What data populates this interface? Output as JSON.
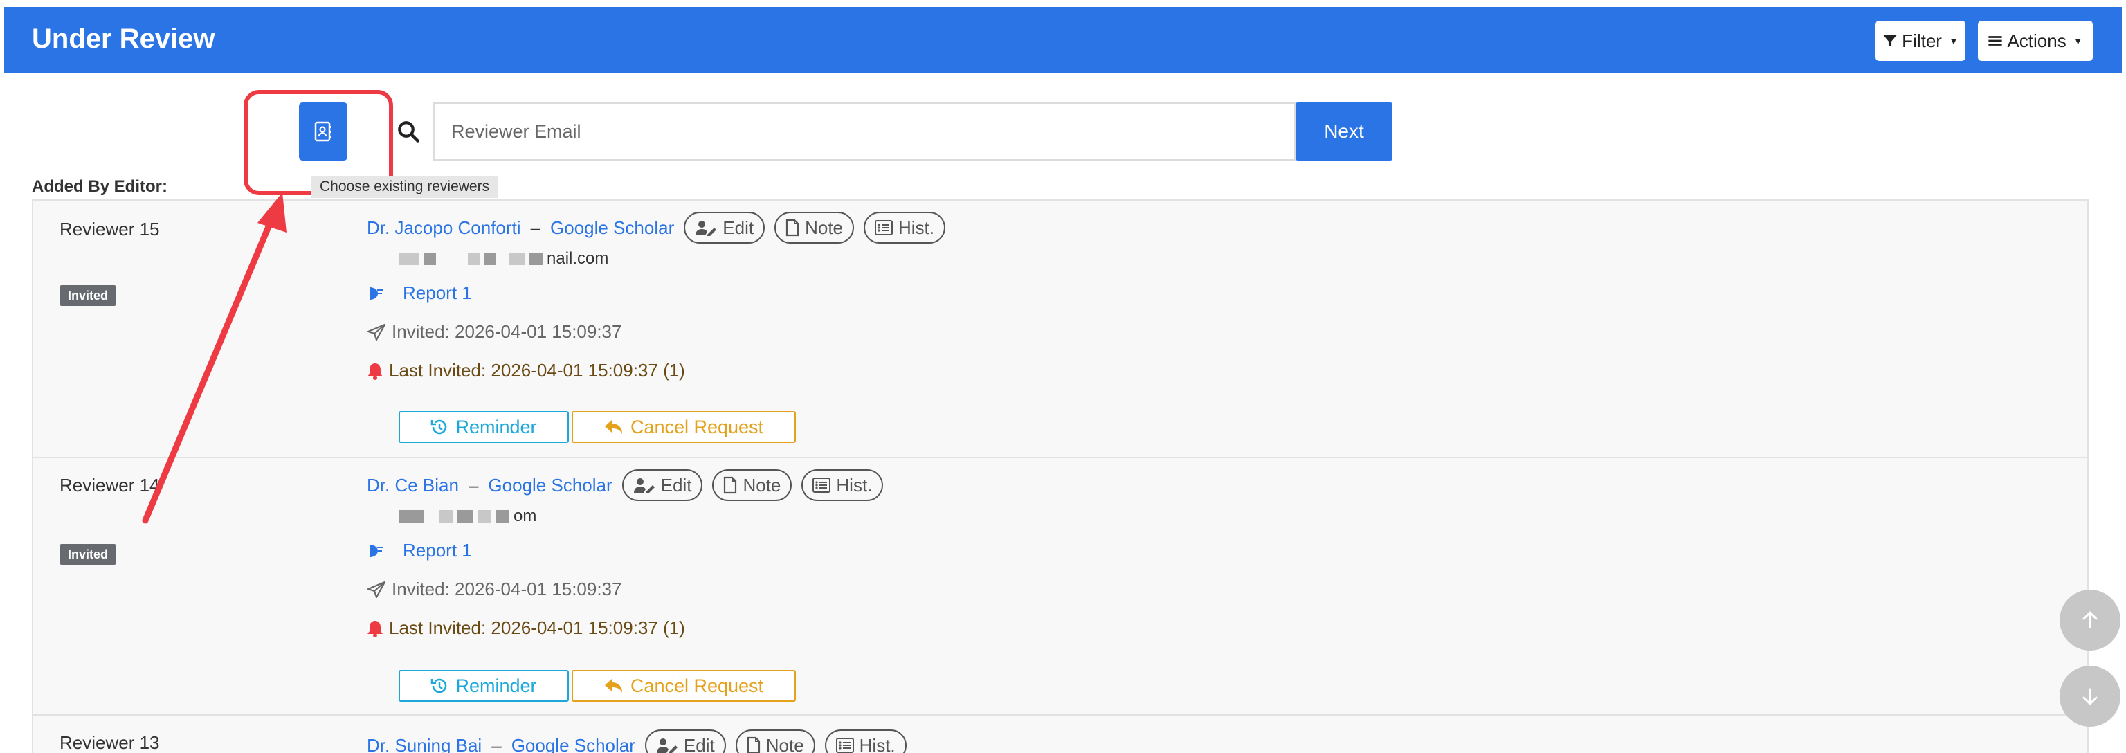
{
  "header": {
    "title": "Under Review",
    "filter_label": "Filter",
    "actions_label": "Actions"
  },
  "search": {
    "placeholder": "Reviewer Email",
    "next_label": "Next",
    "tooltip": "Choose existing reviewers"
  },
  "section_label": "Added By Editor:",
  "reviewers": [
    {
      "name": "Reviewer 15",
      "badge": "Invited",
      "person": "Dr. Jacopo Conforti",
      "scholar": "Google Scholar",
      "email_visible": "nail.com",
      "report": "Report 1",
      "invited": "Invited: 2026-04-01 15:09:37",
      "last_invited": "Last Invited: 2026-04-01 15:09:37 (1)"
    },
    {
      "name": "Reviewer 14",
      "badge": "Invited",
      "person": "Dr. Ce Bian",
      "scholar": "Google Scholar",
      "email_visible": "om",
      "report": "Report 1",
      "invited": "Invited: 2026-04-01 15:09:37",
      "last_invited": "Last Invited: 2026-04-01 15:09:37 (1)"
    },
    {
      "name": "Reviewer 13",
      "person": "Dr. Suning Bai",
      "scholar": "Google Scholar"
    }
  ],
  "row_buttons": {
    "edit": "Edit",
    "note": "Note",
    "hist": "Hist.",
    "reminder": "Reminder",
    "cancel": "Cancel Request"
  },
  "colors": {
    "primary": "#2a74e6",
    "annotation": "#ee3b43",
    "reminder": "#1ca8d8",
    "cancel": "#e4a11b"
  }
}
